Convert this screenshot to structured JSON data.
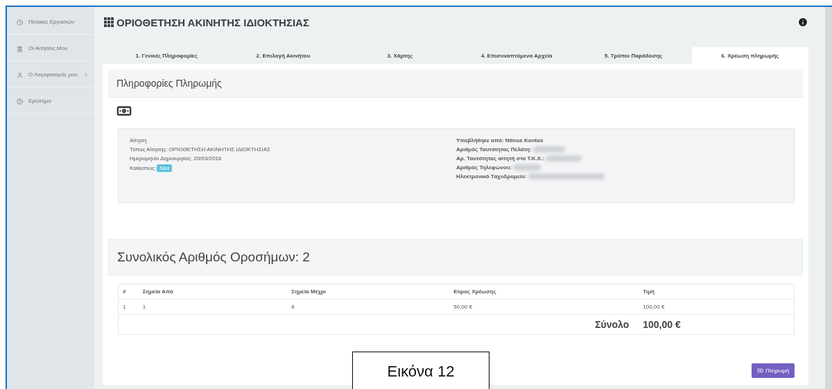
{
  "sidebar": {
    "items": [
      {
        "label": "Πίνακας Εργασιών",
        "submenu": false
      },
      {
        "label": "Οι Αιτήσεις Μου",
        "submenu": false
      },
      {
        "label": "Ο Λογαριασμός μου",
        "submenu": true
      },
      {
        "label": "Ερώτημα",
        "submenu": false
      }
    ]
  },
  "header": {
    "title": "ΟΡΙΟΘΕΤΗΣΗ ΑΚΙΝΗΤΗΣ ΙΔΙΟΚΤΗΣΙΑΣ"
  },
  "tabs": [
    {
      "label": "1. Γενικές Πληροφορίες",
      "selected": false
    },
    {
      "label": "2. Επιλογή Ακινήτου",
      "selected": false
    },
    {
      "label": "3. Χάρτης",
      "selected": false
    },
    {
      "label": "4. Επισυναπτόμενα Αρχεία",
      "selected": false
    },
    {
      "label": "5. Τρόποι Παράδοσης",
      "selected": false
    },
    {
      "label": "6. Χρέωση πληρωμής",
      "selected": true
    }
  ],
  "payment_section": {
    "title": "Πληροφορίες Πληρωμής"
  },
  "application": {
    "heading": "Αίτηση",
    "left_lines": [
      "Τύπος Αίτησης: ΟΡΙΟΘΕΤΗΣΗ ΑΚΙΝΗΤΗΣ ΙΔΙΟΚΤΗΣΙΑΣ",
      "Ημερομηνία Δημιουργίας: 20/03/2016"
    ],
    "status_label": "Καθεστώς:",
    "status_badge": "Νέα",
    "submitted_by": "Υποβλήθηκε από: Ntinos Kontos",
    "right_fields": [
      {
        "label": "Αριθμός Ταυτότητας Πελάτη:",
        "redacted": true
      },
      {
        "label": "Αρ. Ταυτότητας αιτητή στο Τ.Κ.Χ.:",
        "redacted": true
      },
      {
        "label": "Αριθμός Τηλεφώνου:",
        "redacted": true
      },
      {
        "label": "Ηλεκτρονικό Ταχυδρομείο:",
        "redacted": true
      }
    ]
  },
  "milestones": {
    "title": "Συνολικός Αριθμός Οροσήμων: 2"
  },
  "table": {
    "columns": [
      "#",
      "Σημεία Από",
      "Σημεία Μέχρι",
      "Εύρος Χρέωσης",
      "Τιμή"
    ],
    "rows": [
      [
        "1",
        "1",
        "6",
        "50,00 €",
        "100,00 €"
      ]
    ],
    "total_label": "Σύνολο",
    "total_value": "100,00 €"
  },
  "pay_button": "Πληρωμή",
  "caption": "Εικόνα 12"
}
